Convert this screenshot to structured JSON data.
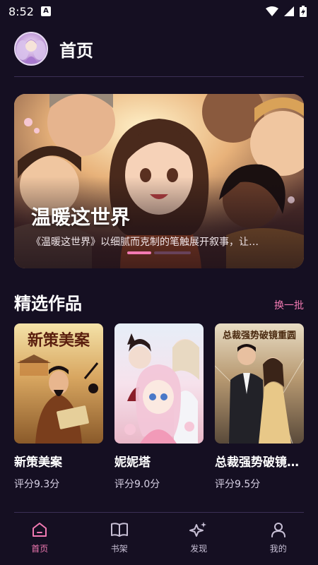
{
  "status_bar": {
    "time": "8:52",
    "app_badge": "A"
  },
  "header": {
    "title": "首页"
  },
  "banner": {
    "title": "温暖这世界",
    "description": "《温暖这世界》以细腻而克制的笔触展开叙事，让…",
    "active_slide": 1
  },
  "section": {
    "title": "精选作品",
    "refresh_label": "换一批"
  },
  "works": [
    {
      "title": "新策美案",
      "score": "评分9.3分",
      "cover_text": "新策美案"
    },
    {
      "title": "妮妮塔",
      "score": "评分9.0分",
      "cover_text": ""
    },
    {
      "title": "总裁强势破镜…",
      "score": "评分9.5分",
      "cover_text": "总裁强势破镜重圆"
    }
  ],
  "nav": {
    "home": "首页",
    "bookshelf": "书架",
    "discover": "发现",
    "mine": "我的"
  },
  "colors": {
    "background": "#150f22",
    "accent": "#f27ab3",
    "divider": "#3b2f55"
  }
}
